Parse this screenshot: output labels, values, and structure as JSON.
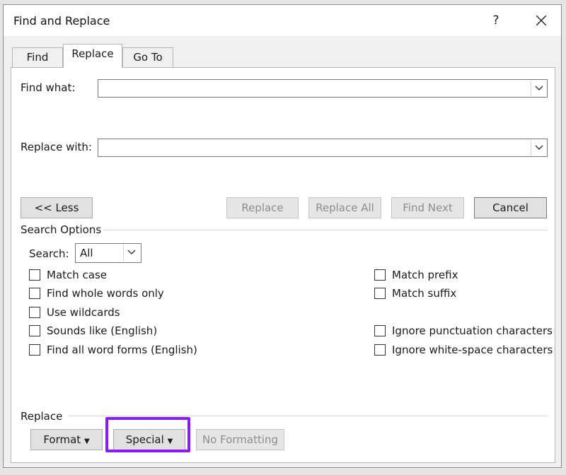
{
  "dialog": {
    "title": "Find and Replace",
    "help_label": "?",
    "tabs": [
      {
        "label": "Find",
        "active": false
      },
      {
        "label": "Replace",
        "active": true
      },
      {
        "label": "Go To",
        "active": false
      }
    ],
    "find_what_label": "Find what:",
    "find_what_value": "",
    "replace_with_label": "Replace with:",
    "replace_with_value": "",
    "buttons": {
      "less": "<< Less",
      "replace": "Replace",
      "replace_all": "Replace All",
      "find_next": "Find Next",
      "cancel": "Cancel"
    },
    "search_options": {
      "section_title": "Search Options",
      "search_label": "Search:",
      "search_value": "All",
      "left_checkboxes": [
        {
          "label": "Match case",
          "checked": false
        },
        {
          "label": "Find whole words only",
          "checked": false
        },
        {
          "label": "Use wildcards",
          "checked": false
        },
        {
          "label": "Sounds like (English)",
          "checked": false
        },
        {
          "label": "Find all word forms (English)",
          "checked": false
        }
      ],
      "right_checkboxes": [
        {
          "label": "Match prefix",
          "checked": false
        },
        {
          "label": "Match suffix",
          "checked": false
        },
        {
          "label": "Ignore punctuation characters",
          "checked": false
        },
        {
          "label": "Ignore white-space characters",
          "checked": false
        }
      ]
    },
    "replace_section": {
      "section_title": "Replace",
      "format_label": "Format",
      "special_label": "Special",
      "no_formatting_label": "No Formatting"
    },
    "highlight_color": "#8a1cf0"
  }
}
